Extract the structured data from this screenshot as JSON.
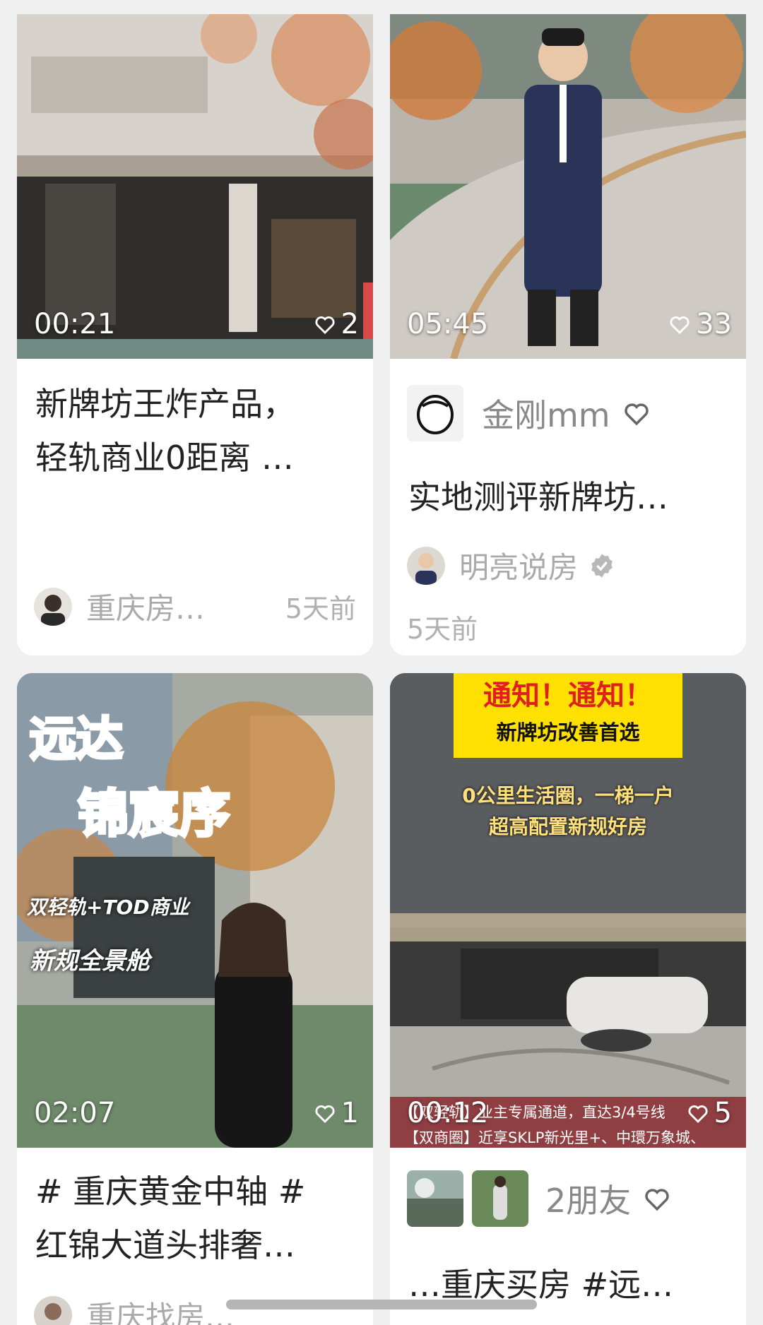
{
  "cards": [
    {
      "duration": "00:21",
      "likes": "2",
      "title_line1": "新牌坊王炸产品，",
      "title_line2": "轻轨商业0距离 …",
      "author": "重庆房…",
      "time": "5天前"
    },
    {
      "duration": "05:45",
      "likes": "33",
      "friend_name": "金刚mm",
      "title": "实地测评新牌坊…",
      "author": "明亮说房",
      "time": "5天前"
    },
    {
      "duration": "02:07",
      "likes": "1",
      "overlay_title1": "远达",
      "overlay_title2": "锦宸序",
      "overlay_sub1": "双轻轨+TOD商业",
      "overlay_sub2": "新规全景舱",
      "title_line1": "# 重庆黄金中轴 #",
      "title_line2": "红锦大道头排奢…",
      "author": "重庆找房…"
    },
    {
      "duration": "00:12",
      "likes": "5",
      "banner_title": "通知！通知！",
      "banner_sub": "新牌坊改善首选",
      "overlay_line1": "0公里生活圈，一梯一户",
      "overlay_line2": "超高配置新规好房",
      "bottom_line1": "【双轻轨】业主专属通道，直达3/4号线",
      "bottom_line2": "【双商圈】近享SKLP新光里+、中環万象城、",
      "friend_name": "2朋友",
      "title": "…重庆买房 #远…"
    }
  ]
}
